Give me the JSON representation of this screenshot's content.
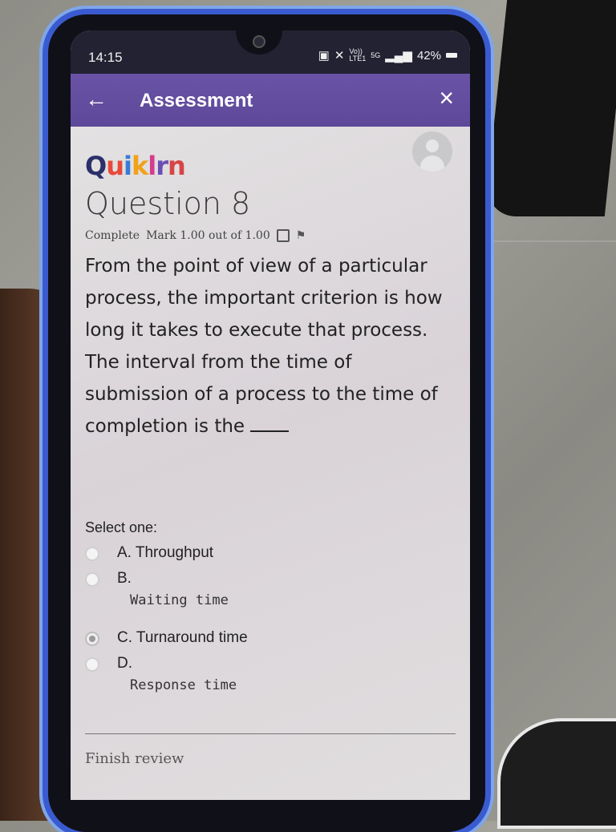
{
  "status": {
    "time": "14:15",
    "battery": "42%",
    "network": "5G",
    "network_sub": "LTE1",
    "volte": "Vo))"
  },
  "appbar": {
    "title": "Assessment"
  },
  "logo": {
    "parts": [
      "Q",
      "u",
      "i",
      "k",
      "l",
      "r",
      "n"
    ]
  },
  "question": {
    "title": "Question 8",
    "state": "Complete",
    "mark": "Mark 1.00 out of 1.00",
    "text": "From the point of view of a particular process, the important criterion is how long it takes to execute that process. The interval from the time of submission of a process to the time of completion is the"
  },
  "answer": {
    "select_label": "Select one:",
    "options": [
      {
        "label": "A. Throughput",
        "subtext": "",
        "checked": false
      },
      {
        "label": "B.",
        "subtext": "Waiting time",
        "checked": false
      },
      {
        "label": "C. Turnaround time",
        "subtext": "",
        "checked": true
      },
      {
        "label": "D.",
        "subtext": "Response time",
        "checked": false
      }
    ]
  },
  "footer": {
    "finish_label": "Finish review"
  },
  "icons": {
    "back": "arrow-left-icon",
    "close": "close-icon",
    "flag": "flag-icon",
    "avatar": "user-avatar-icon"
  },
  "colors": {
    "appbar": "#5d4899",
    "statusbar": "#222233"
  }
}
